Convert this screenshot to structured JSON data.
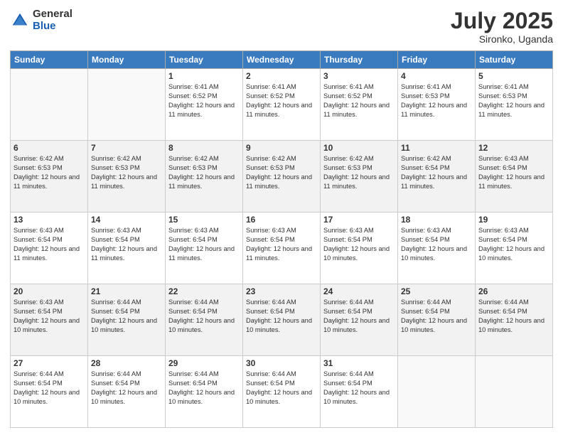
{
  "header": {
    "logo": {
      "general": "General",
      "blue": "Blue"
    },
    "title": "July 2025",
    "location": "Sironko, Uganda"
  },
  "days_of_week": [
    "Sunday",
    "Monday",
    "Tuesday",
    "Wednesday",
    "Thursday",
    "Friday",
    "Saturday"
  ],
  "weeks": [
    [
      {
        "day": "",
        "info": ""
      },
      {
        "day": "",
        "info": ""
      },
      {
        "day": "1",
        "info": "Sunrise: 6:41 AM\nSunset: 6:52 PM\nDaylight: 12 hours and 11 minutes."
      },
      {
        "day": "2",
        "info": "Sunrise: 6:41 AM\nSunset: 6:52 PM\nDaylight: 12 hours and 11 minutes."
      },
      {
        "day": "3",
        "info": "Sunrise: 6:41 AM\nSunset: 6:52 PM\nDaylight: 12 hours and 11 minutes."
      },
      {
        "day": "4",
        "info": "Sunrise: 6:41 AM\nSunset: 6:53 PM\nDaylight: 12 hours and 11 minutes."
      },
      {
        "day": "5",
        "info": "Sunrise: 6:41 AM\nSunset: 6:53 PM\nDaylight: 12 hours and 11 minutes."
      }
    ],
    [
      {
        "day": "6",
        "info": "Sunrise: 6:42 AM\nSunset: 6:53 PM\nDaylight: 12 hours and 11 minutes."
      },
      {
        "day": "7",
        "info": "Sunrise: 6:42 AM\nSunset: 6:53 PM\nDaylight: 12 hours and 11 minutes."
      },
      {
        "day": "8",
        "info": "Sunrise: 6:42 AM\nSunset: 6:53 PM\nDaylight: 12 hours and 11 minutes."
      },
      {
        "day": "9",
        "info": "Sunrise: 6:42 AM\nSunset: 6:53 PM\nDaylight: 12 hours and 11 minutes."
      },
      {
        "day": "10",
        "info": "Sunrise: 6:42 AM\nSunset: 6:53 PM\nDaylight: 12 hours and 11 minutes."
      },
      {
        "day": "11",
        "info": "Sunrise: 6:42 AM\nSunset: 6:54 PM\nDaylight: 12 hours and 11 minutes."
      },
      {
        "day": "12",
        "info": "Sunrise: 6:43 AM\nSunset: 6:54 PM\nDaylight: 12 hours and 11 minutes."
      }
    ],
    [
      {
        "day": "13",
        "info": "Sunrise: 6:43 AM\nSunset: 6:54 PM\nDaylight: 12 hours and 11 minutes."
      },
      {
        "day": "14",
        "info": "Sunrise: 6:43 AM\nSunset: 6:54 PM\nDaylight: 12 hours and 11 minutes."
      },
      {
        "day": "15",
        "info": "Sunrise: 6:43 AM\nSunset: 6:54 PM\nDaylight: 12 hours and 11 minutes."
      },
      {
        "day": "16",
        "info": "Sunrise: 6:43 AM\nSunset: 6:54 PM\nDaylight: 12 hours and 11 minutes."
      },
      {
        "day": "17",
        "info": "Sunrise: 6:43 AM\nSunset: 6:54 PM\nDaylight: 12 hours and 10 minutes."
      },
      {
        "day": "18",
        "info": "Sunrise: 6:43 AM\nSunset: 6:54 PM\nDaylight: 12 hours and 10 minutes."
      },
      {
        "day": "19",
        "info": "Sunrise: 6:43 AM\nSunset: 6:54 PM\nDaylight: 12 hours and 10 minutes."
      }
    ],
    [
      {
        "day": "20",
        "info": "Sunrise: 6:43 AM\nSunset: 6:54 PM\nDaylight: 12 hours and 10 minutes."
      },
      {
        "day": "21",
        "info": "Sunrise: 6:44 AM\nSunset: 6:54 PM\nDaylight: 12 hours and 10 minutes."
      },
      {
        "day": "22",
        "info": "Sunrise: 6:44 AM\nSunset: 6:54 PM\nDaylight: 12 hours and 10 minutes."
      },
      {
        "day": "23",
        "info": "Sunrise: 6:44 AM\nSunset: 6:54 PM\nDaylight: 12 hours and 10 minutes."
      },
      {
        "day": "24",
        "info": "Sunrise: 6:44 AM\nSunset: 6:54 PM\nDaylight: 12 hours and 10 minutes."
      },
      {
        "day": "25",
        "info": "Sunrise: 6:44 AM\nSunset: 6:54 PM\nDaylight: 12 hours and 10 minutes."
      },
      {
        "day": "26",
        "info": "Sunrise: 6:44 AM\nSunset: 6:54 PM\nDaylight: 12 hours and 10 minutes."
      }
    ],
    [
      {
        "day": "27",
        "info": "Sunrise: 6:44 AM\nSunset: 6:54 PM\nDaylight: 12 hours and 10 minutes."
      },
      {
        "day": "28",
        "info": "Sunrise: 6:44 AM\nSunset: 6:54 PM\nDaylight: 12 hours and 10 minutes."
      },
      {
        "day": "29",
        "info": "Sunrise: 6:44 AM\nSunset: 6:54 PM\nDaylight: 12 hours and 10 minutes."
      },
      {
        "day": "30",
        "info": "Sunrise: 6:44 AM\nSunset: 6:54 PM\nDaylight: 12 hours and 10 minutes."
      },
      {
        "day": "31",
        "info": "Sunrise: 6:44 AM\nSunset: 6:54 PM\nDaylight: 12 hours and 10 minutes."
      },
      {
        "day": "",
        "info": ""
      },
      {
        "day": "",
        "info": ""
      }
    ]
  ]
}
